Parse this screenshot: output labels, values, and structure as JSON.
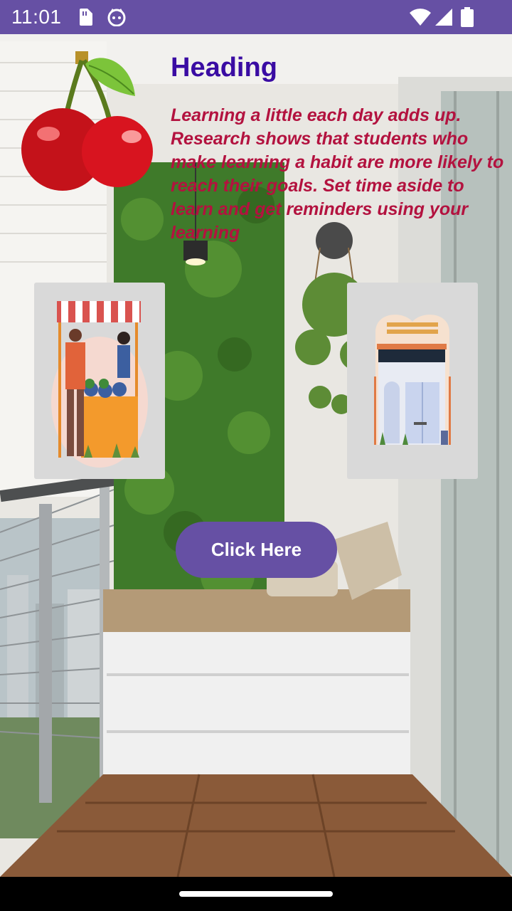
{
  "status_bar": {
    "time": "11:01",
    "icons": [
      "sim-card-icon",
      "cat-app-icon",
      "wifi-icon",
      "signal-icon",
      "battery-icon"
    ],
    "color": "#6650a4"
  },
  "content": {
    "heading": "Heading",
    "paragraph": "Learning a little each day adds up. Research shows that students who make learning a habit are more likely to reach their goals. Set time aside to learn and get reminders using your learning",
    "heading_color": "#3a0ca3",
    "paragraph_color": "#b3123f"
  },
  "images": {
    "left_card": "market-stall-illustration",
    "right_card": "cafe-storefront-illustration",
    "logo": "cherries-icon"
  },
  "button": {
    "label": "Click Here",
    "color": "#6650a4"
  }
}
